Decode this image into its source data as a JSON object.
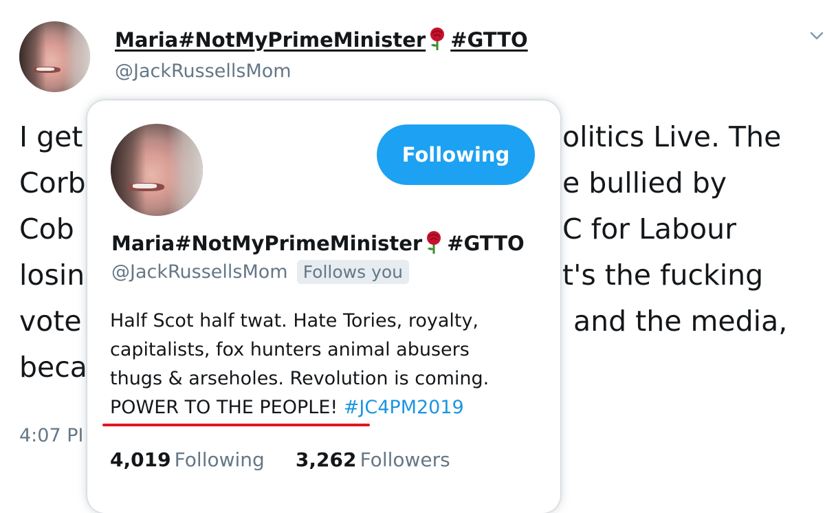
{
  "tweet": {
    "author_name": "Maria#NotMyPrimeMinister",
    "author_tag": "#GTTO",
    "handle": "@JackRussellsMom",
    "visible_text_lines": [
      "I get",
      "Corb",
      "Cob",
      "losin",
      "vote",
      "beca"
    ],
    "visible_text_right": [
      "olitics Live. The",
      "e bullied by",
      "C for Labour",
      "t's the fucking",
      "and the media,"
    ],
    "timestamp": "4:07 PI",
    "menu_icon": "chevron-down-icon"
  },
  "hover_card": {
    "follow_button": "Following",
    "name": "Maria#NotMyPrimeMinister",
    "name_tag": "#GTTO",
    "handle": "@JackRussellsMom",
    "follows_you": "Follows you",
    "bio_lines": [
      "Half Scot half twat. Hate Tories, royalty,",
      "capitalists, fox hunters animal abusers",
      "thugs & arseholes. Revolution is coming."
    ],
    "bio_last_plain": "POWER TO THE PEOPLE!",
    "bio_last_hashtag": "#JC4PM2019",
    "following_count": "4,019",
    "following_label": "Following",
    "followers_count": "3,262",
    "followers_label": "Followers"
  },
  "colors": {
    "accent_blue": "#1da1f2",
    "hashtag_blue": "#1b95e0",
    "muted_gray": "#657786",
    "annotation_red": "#e0171f",
    "rose_red": "#c8102e"
  },
  "icons": [
    "rose-emoji-icon",
    "chevron-down-icon"
  ]
}
